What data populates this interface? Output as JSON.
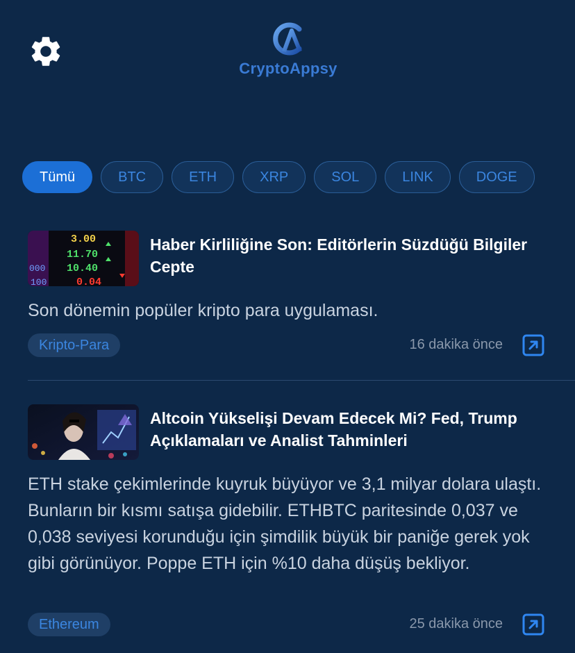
{
  "header": {
    "app_name": "CryptoAppsy",
    "settings_icon": "gear-icon",
    "brand_color": "#3a7bd5"
  },
  "filters": [
    {
      "label": "Tümü",
      "active": true
    },
    {
      "label": "BTC",
      "active": false
    },
    {
      "label": "ETH",
      "active": false
    },
    {
      "label": "XRP",
      "active": false
    },
    {
      "label": "SOL",
      "active": false
    },
    {
      "label": "LINK",
      "active": false
    },
    {
      "label": "DOGE",
      "active": false
    }
  ],
  "articles": [
    {
      "title": "Haber Kirliliğine Son: Editörlerin Süzdüğü Bilgiler Cepte",
      "description": "Son dönemin popüler kripto para uygulaması.",
      "tag": "Kripto-Para",
      "time": "16 dakika önce",
      "thumb_numbers": [
        "3.00",
        "11.70",
        "10.40",
        "0.04",
        "000",
        "100"
      ],
      "link_icon": "external-link-icon"
    },
    {
      "title": "Altcoin Yükselişi Devam Edecek Mi? Fed, Trump Açıklamaları ve Analist Tahminleri",
      "description": "ETH stake çekimlerinde kuyruk büyüyor ve 3,1 milyar dolara ulaştı. Bunların bir kısmı satışa gidebilir. ETHBTC paritesinde 0,037 ve 0,038 seviyesi korunduğu için şimdilik büyük bir paniğe gerek yok gibi görünüyor. Poppe ETH için %10 daha düşüş bekliyor.",
      "tag": "Ethereum",
      "time": "25 dakika önce",
      "link_icon": "external-link-icon"
    }
  ],
  "colors": {
    "background": "#0d2848",
    "accent": "#1c6fd6",
    "chip_text": "#3b86e0"
  }
}
